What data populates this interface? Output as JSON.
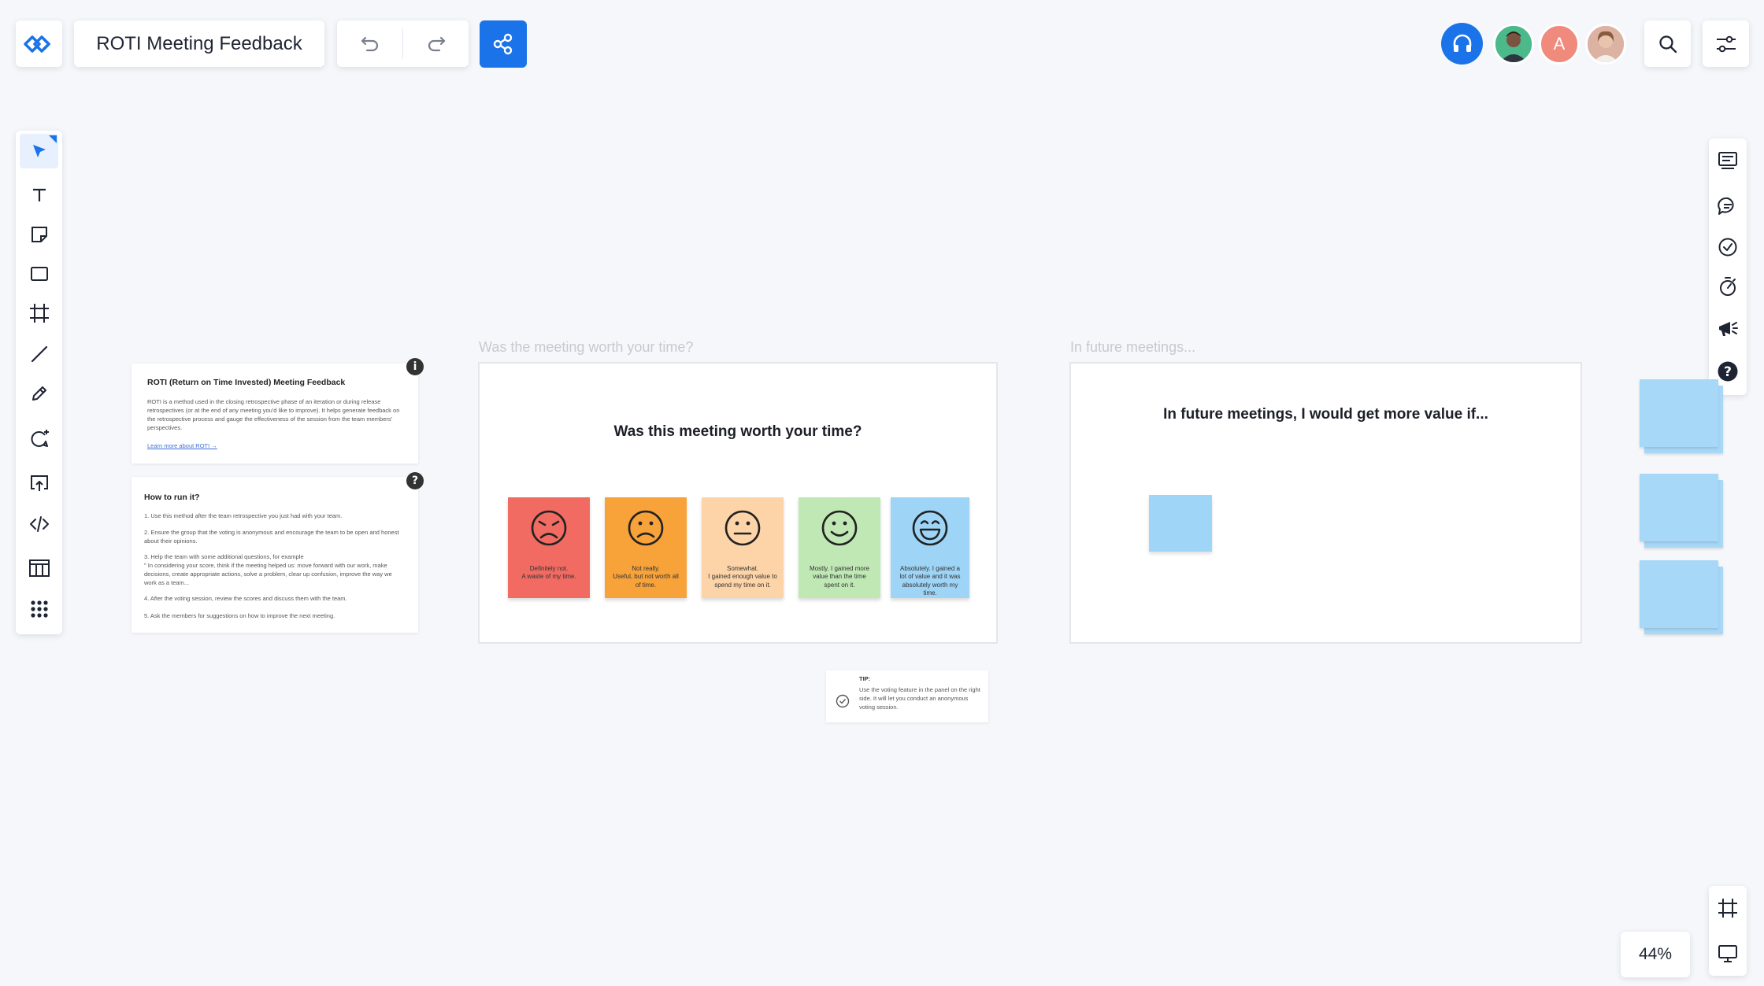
{
  "app": {
    "board_title": "ROTI Meeting Feedback",
    "zoom": "44%",
    "avatar_initial": "A",
    "accent": "#1a73e8"
  },
  "icons": {
    "logo": "miro-logo-icon",
    "undo": "undo-icon",
    "redo": "redo-icon",
    "share": "share-icon",
    "headset": "headset-icon",
    "search": "search-icon",
    "settings": "sliders-icon"
  },
  "left_toolbar": [
    "select",
    "text",
    "sticky-note",
    "shape",
    "frame",
    "line",
    "pen",
    "comment",
    "upload",
    "embed-code",
    "template",
    "more-apps"
  ],
  "right_toolbar": [
    "agenda",
    "chat",
    "voting",
    "timer",
    "announce",
    "help"
  ],
  "bottom_toolbar": [
    "frames",
    "present"
  ],
  "info_card_1": {
    "title": "ROTI (Return on Time Invested) Meeting Feedback",
    "body": "ROTI is a method used in the closing retrospective phase of an iteration or during release retrospectives (or at the end of any meeting you'd like to improve). It helps generate feedback on the retrospective process and gauge the effectiveness of the session from the team members' perspectives.",
    "link": "Learn more about ROTI →",
    "badge": "i"
  },
  "info_card_2": {
    "title": "How to run it?",
    "steps": [
      "1. Use this method after the team retrospective you just had with your team.",
      "2. Ensure the group that the voting is anonymous and encourage the team to be open and honest about their opinions.",
      "3. Help the team with some additional questions, for example\n\" In considering your score, think if the meeting helped us: move forward with our work, make decisions, create appropriate actions, solve a problem, clear up confusion, improve the way we work as a team...",
      "4. After the voting session, review the scores and discuss them with the team.",
      "5. Ask the members for suggestions on how to improve the next meeting."
    ],
    "badge": "?"
  },
  "frame_worth": {
    "label": "Was the meeting worth your time?",
    "heading": "Was this meeting worth your time?",
    "stickies": [
      {
        "text": "Definitely not.\nA waste of my time.",
        "color": "#f16b62",
        "mood": "very-sad"
      },
      {
        "text": "Not really.\nUseful, but not worth all of time.",
        "color": "#f8a23a",
        "mood": "sad"
      },
      {
        "text": "Somewhat.\nI gained enough value to spend my time on it.",
        "color": "#fdd4a7",
        "mood": "neutral"
      },
      {
        "text": "Mostly. I gained more value than the time spent on it.",
        "color": "#bfe8b5",
        "mood": "happy"
      },
      {
        "text": "Absolutely. I gained a lot of value and it was absolutely worth my time.",
        "color": "#9ed4f6",
        "mood": "very-happy"
      }
    ]
  },
  "frame_future": {
    "label": "In future meetings...",
    "heading": "In future meetings, I would get more value if..."
  },
  "tip": {
    "title": "TIP:",
    "body": "Use the voting feature in the panel on the right side. It will let you conduct an anonymous voting session."
  }
}
